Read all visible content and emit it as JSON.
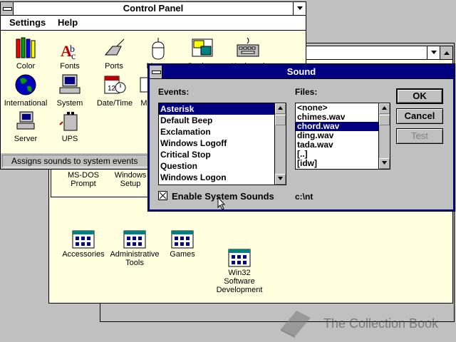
{
  "control_panel": {
    "title": "Control Panel",
    "menu": [
      {
        "label": "Settings"
      },
      {
        "label": "Help"
      }
    ],
    "icons": [
      {
        "label": "Color",
        "icon": "color-icon"
      },
      {
        "label": "Fonts",
        "icon": "fonts-icon"
      },
      {
        "label": "Ports",
        "icon": "ports-icon"
      },
      {
        "label": "Mouse",
        "icon": "mouse-icon"
      },
      {
        "label": "Desktop",
        "icon": "desktop-icon"
      },
      {
        "label": "Keyboard",
        "icon": "keyboard-icon"
      },
      {
        "label": "International",
        "icon": "globe-icon"
      },
      {
        "label": "System",
        "icon": "system-icon"
      },
      {
        "label": "Date/Time",
        "icon": "calendar-clock-icon"
      },
      {
        "label": "MIDI",
        "icon": "midi-icon"
      },
      {
        "label": "Server",
        "icon": "server-icon"
      },
      {
        "label": "UPS",
        "icon": "ups-icon"
      }
    ],
    "status": "Assigns sounds to system events"
  },
  "program_manager": {
    "top_icons": [
      {
        "label": "MS-DOS\nPrompt"
      },
      {
        "label": "Windows\nSetup"
      }
    ],
    "groups": [
      {
        "label": "Accessories"
      },
      {
        "label": "Administrative\nTools"
      },
      {
        "label": "Games"
      },
      {
        "label": "Win32\nSoftware\nDevelopment"
      }
    ]
  },
  "sound_dialog": {
    "title": "Sound",
    "events_label": "Events:",
    "events": [
      "Asterisk",
      "Default Beep",
      "Exclamation",
      "Windows Logoff",
      "Critical Stop",
      "Question",
      "Windows Logon"
    ],
    "files_label": "Files:",
    "files": [
      "<none>",
      "chimes.wav",
      "chord.wav",
      "ding.wav",
      "tada.wav",
      "[..]",
      "[idw]"
    ],
    "enable_label": "Enable System Sounds",
    "enable_checked": true,
    "path": "c:\\nt",
    "ok_label": "OK",
    "cancel_label": "Cancel",
    "test_label": "Test"
  },
  "watermark": "The Collection Book"
}
